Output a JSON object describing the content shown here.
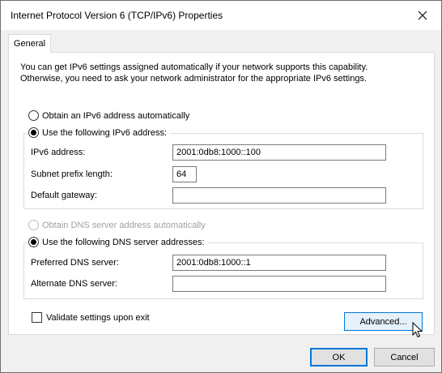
{
  "window": {
    "title": "Internet Protocol Version 6 (TCP/IPv6) Properties",
    "close_icon": "close-icon"
  },
  "tabs": [
    {
      "label": "General"
    }
  ],
  "general": {
    "description_line1": "You can get IPv6 settings assigned automatically if your network supports this capability.",
    "description_line2": "Otherwise, you need to ask your network administrator for the appropriate IPv6 settings.",
    "address_mode": {
      "auto_label": "Obtain an IPv6 address automatically",
      "manual_label": "Use the following IPv6 address:",
      "selected": "manual"
    },
    "ipv6_address": {
      "label": "IPv6 address:",
      "value": "2001:0db8:1000::100"
    },
    "subnet_prefix": {
      "label": "Subnet prefix length:",
      "value": "64"
    },
    "default_gateway": {
      "label": "Default gateway:",
      "value": ""
    },
    "dns_mode": {
      "auto_label": "Obtain DNS server address automatically",
      "manual_label": "Use the following DNS server addresses:",
      "selected": "manual",
      "auto_disabled": true
    },
    "preferred_dns": {
      "label": "Preferred DNS server:",
      "value": "2001:0db8:1000::1"
    },
    "alternate_dns": {
      "label": "Alternate DNS server:",
      "value": ""
    },
    "validate_on_exit": {
      "label": "Validate settings upon exit",
      "checked": false
    },
    "advanced_label": "Advanced..."
  },
  "footer": {
    "ok_label": "OK",
    "cancel_label": "Cancel"
  },
  "colors": {
    "accent": "#0078d7",
    "window_bg": "#f0f0f0",
    "disabled_text": "#a0a0a0"
  }
}
